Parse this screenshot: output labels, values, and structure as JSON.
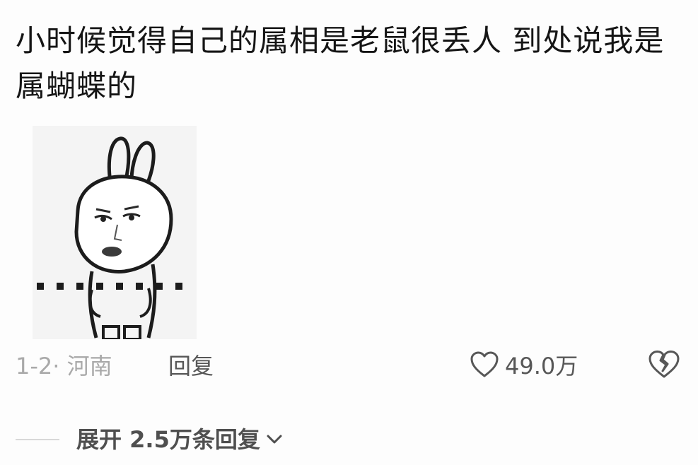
{
  "comment": {
    "text": "小时候觉得自己的属相是老鼠很丢人 到处说我是属蝴蝶的",
    "sticker_icon": "rabbit-meme-icon",
    "date": "1-2· 河南",
    "reply_label": "回复",
    "like_icon": "heart-icon",
    "like_count": "49.0万",
    "dislike_icon": "broken-heart-icon"
  },
  "replies": {
    "expand_label": "展开 2.5万条回复",
    "chevron_icon": "chevron-down-icon"
  },
  "colors": {
    "text_primary": "#151515",
    "text_muted": "#a9a9a9",
    "text_secondary": "#575757",
    "background": "#fdfdfd"
  }
}
